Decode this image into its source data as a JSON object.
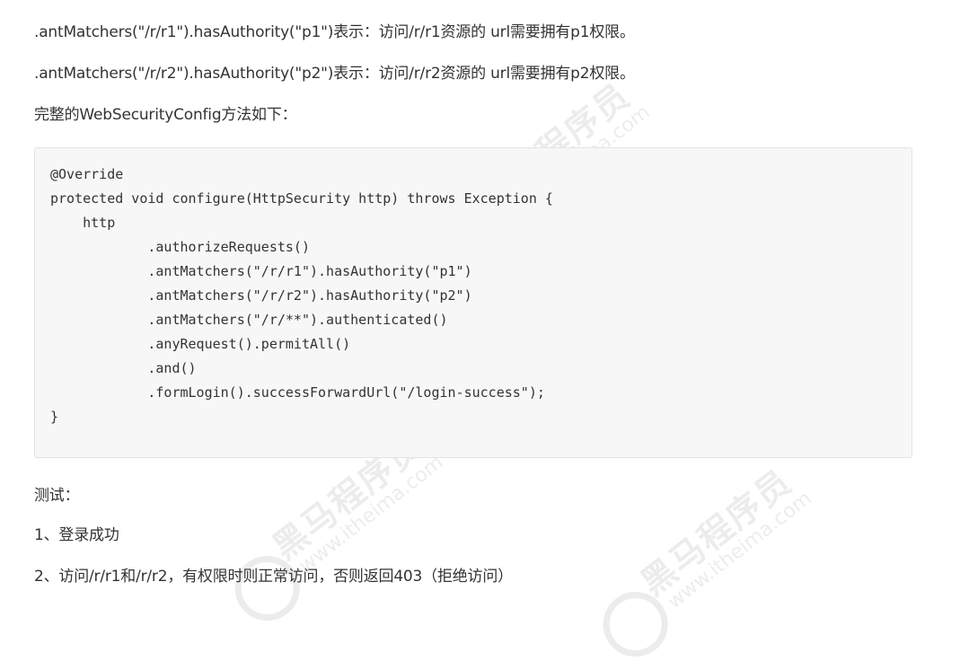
{
  "paragraphs": {
    "p1": ".antMatchers(\"/r/r1\").hasAuthority(\"p1\")表示：访问/r/r1资源的 url需要拥有p1权限。",
    "p2": ".antMatchers(\"/r/r2\").hasAuthority(\"p2\")表示：访问/r/r2资源的 url需要拥有p2权限。",
    "p3": "完整的WebSecurityConfig方法如下："
  },
  "code": {
    "lines": [
      "@Override",
      "protected void configure(HttpSecurity http) throws Exception {",
      "    http",
      "            .authorizeRequests()",
      "            .antMatchers(\"/r/r1\").hasAuthority(\"p1\")",
      "            .antMatchers(\"/r/r2\").hasAuthority(\"p2\")",
      "            .antMatchers(\"/r/**\").authenticated()",
      "            .anyRequest().permitAll()",
      "            .and()",
      "            .formLogin().successForwardUrl(\"/login-success\");",
      "}"
    ]
  },
  "test": {
    "heading": "测试：",
    "items": [
      "1、登录成功",
      "2、访问/r/r1和/r/r2，有权限时则正常访问，否则返回403（拒绝访问）"
    ]
  },
  "watermark": {
    "brand": "黑马程序员",
    "url": "www.itheima.com"
  }
}
